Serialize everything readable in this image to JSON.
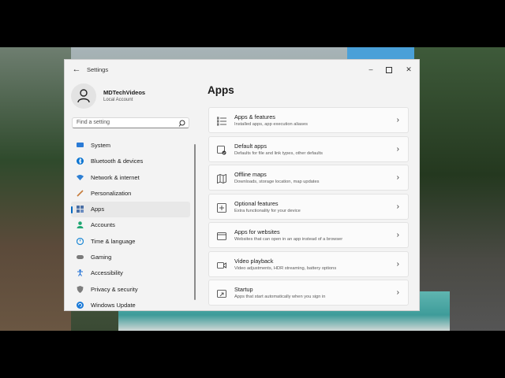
{
  "window": {
    "title": "Settings",
    "back": "←",
    "minimize": "–",
    "close": "✕"
  },
  "profile": {
    "name": "MDTechVideos",
    "account_type": "Local Account"
  },
  "search": {
    "placeholder": "Find a setting"
  },
  "sidebar": {
    "selected": "Apps",
    "items": [
      {
        "label": "System",
        "icon": "monitor-icon",
        "color": "#2b7bd6"
      },
      {
        "label": "Bluetooth & devices",
        "icon": "bluetooth-icon",
        "color": "#0a74d1"
      },
      {
        "label": "Network & internet",
        "icon": "wifi-icon",
        "color": "#2d7fd3"
      },
      {
        "label": "Personalization",
        "icon": "brush-icon",
        "color": "#c67a3a"
      },
      {
        "label": "Apps",
        "icon": "apps-icon",
        "color": "#4a6fa5"
      },
      {
        "label": "Accounts",
        "icon": "person-icon",
        "color": "#1fa672"
      },
      {
        "label": "Time & language",
        "icon": "globe-clock-icon",
        "color": "#1f8ad6"
      },
      {
        "label": "Gaming",
        "icon": "controller-icon",
        "color": "#7a7a7a"
      },
      {
        "label": "Accessibility",
        "icon": "accessibility-icon",
        "color": "#1e6fd6"
      },
      {
        "label": "Privacy & security",
        "icon": "shield-icon",
        "color": "#7d7d7d"
      },
      {
        "label": "Windows Update",
        "icon": "update-icon",
        "color": "#1a7ad8"
      }
    ]
  },
  "main": {
    "title": "Apps",
    "cards": [
      {
        "title": "Apps & features",
        "subtitle": "Installed apps, app execution aliases",
        "icon": "list-icon"
      },
      {
        "title": "Default apps",
        "subtitle": "Defaults for file and link types, other defaults",
        "icon": "default-apps-icon"
      },
      {
        "title": "Offline maps",
        "subtitle": "Downloads, storage location, map updates",
        "icon": "map-icon"
      },
      {
        "title": "Optional features",
        "subtitle": "Extra functionality for your device",
        "icon": "add-feature-icon"
      },
      {
        "title": "Apps for websites",
        "subtitle": "Websites that can open in an app instead of a browser",
        "icon": "web-apps-icon"
      },
      {
        "title": "Video playback",
        "subtitle": "Video adjustments, HDR streaming, battery options",
        "icon": "video-icon"
      },
      {
        "title": "Startup",
        "subtitle": "Apps that start automatically when you sign in",
        "icon": "startup-icon"
      }
    ],
    "chevron": "›"
  }
}
